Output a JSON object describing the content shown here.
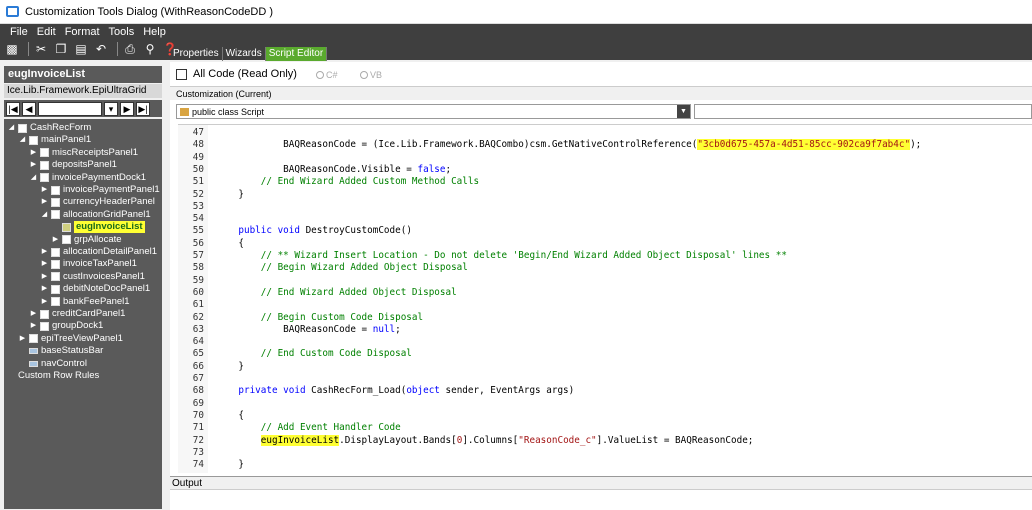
{
  "window": {
    "title": "Customization Tools Dialog  (WithReasonCodeDD )"
  },
  "menu": [
    "File",
    "Edit",
    "Format",
    "Tools",
    "Help"
  ],
  "toolbar": {
    "icons": [
      "save-icon",
      "cut-icon",
      "copy-icon",
      "paste-icon",
      "undo-icon",
      "print-icon",
      "find-icon",
      "help-icon"
    ]
  },
  "left_panel": {
    "object_name": "eugInvoiceList",
    "object_type": "Ice.Lib.Framework.EpiUltraGrid",
    "tree": [
      {
        "label": "CashRecForm",
        "indent": 0,
        "exp": "down",
        "icon": "sq"
      },
      {
        "label": "mainPanel1",
        "indent": 1,
        "exp": "down",
        "icon": "sq"
      },
      {
        "label": "miscReceiptsPanel1",
        "indent": 2,
        "exp": "right",
        "icon": "sq"
      },
      {
        "label": "depositsPanel1",
        "indent": 2,
        "exp": "right",
        "icon": "sq"
      },
      {
        "label": "invoicePaymentDock1",
        "indent": 2,
        "exp": "down",
        "icon": "sq"
      },
      {
        "label": "invoicePaymentPanel1",
        "indent": 3,
        "exp": "right",
        "icon": "sq"
      },
      {
        "label": "currencyHeaderPanel",
        "indent": 3,
        "exp": "right",
        "icon": "sq"
      },
      {
        "label": "allocationGridPanel1",
        "indent": 3,
        "exp": "down",
        "icon": "sq"
      },
      {
        "label": "eugInvoiceList",
        "indent": 4,
        "exp": "",
        "icon": "grid",
        "selected": true
      },
      {
        "label": "grpAllocate",
        "indent": 4,
        "exp": "right",
        "icon": "sq"
      },
      {
        "label": "allocationDetailPanel1",
        "indent": 3,
        "exp": "right",
        "icon": "sq"
      },
      {
        "label": "invoiceTaxPanel1",
        "indent": 3,
        "exp": "right",
        "icon": "sq"
      },
      {
        "label": "custInvoicesPanel1",
        "indent": 3,
        "exp": "right",
        "icon": "sq"
      },
      {
        "label": "debitNoteDocPanel1",
        "indent": 3,
        "exp": "right",
        "icon": "sq"
      },
      {
        "label": "bankFeePanel1",
        "indent": 3,
        "exp": "right",
        "icon": "sq"
      },
      {
        "label": "creditCardPanel1",
        "indent": 2,
        "exp": "right",
        "icon": "sq"
      },
      {
        "label": "groupDock1",
        "indent": 2,
        "exp": "right",
        "icon": "sq"
      },
      {
        "label": "epiTreeViewPanel1",
        "indent": 1,
        "exp": "right",
        "icon": "sq"
      },
      {
        "label": "baseStatusBar",
        "indent": 1,
        "exp": "",
        "icon": "bar"
      },
      {
        "label": "navControl",
        "indent": 1,
        "exp": "",
        "icon": "bar"
      },
      {
        "label": "Custom Row Rules",
        "indent": 0,
        "exp": "",
        "icon": "none"
      }
    ]
  },
  "tabs": [
    "Properties",
    "Wizards",
    "Script Editor"
  ],
  "options": {
    "all_code_label": "All Code (Read Only)",
    "radio_cs": "C#",
    "radio_vb": "VB",
    "customization_label": "Customization (Current)",
    "class_selector": "public class Script"
  },
  "code_lines": [
    {
      "n": "47",
      "segs": []
    },
    {
      "n": "48",
      "segs": [
        {
          "t": "            BAQReasonCode = (Ice.Lib.Framework.BAQCombo)csm.GetNativeControlReference("
        },
        {
          "t": "\"3cb0d675-457a-4d51-85cc-902ca9f7ab4c\"",
          "c": "str hl"
        },
        {
          "t": ");"
        }
      ]
    },
    {
      "n": "49",
      "segs": []
    },
    {
      "n": "50",
      "segs": [
        {
          "t": "            BAQReasonCode.Visible = "
        },
        {
          "t": "false",
          "c": "kw"
        },
        {
          "t": ";"
        }
      ]
    },
    {
      "n": "51",
      "segs": [
        {
          "t": "        "
        },
        {
          "t": "// End Wizard Added Custom Method Calls",
          "c": "cm"
        }
      ]
    },
    {
      "n": "52",
      "segs": [
        {
          "t": "    }"
        }
      ],
      "fold": "-"
    },
    {
      "n": "53",
      "segs": []
    },
    {
      "n": "54",
      "segs": []
    },
    {
      "n": "55",
      "segs": [
        {
          "t": "    "
        },
        {
          "t": "public void",
          "c": "kw"
        },
        {
          "t": " DestroyCustomCode()"
        }
      ]
    },
    {
      "n": "56",
      "segs": [
        {
          "t": "    {"
        }
      ],
      "fold": "⊟"
    },
    {
      "n": "57",
      "segs": [
        {
          "t": "        "
        },
        {
          "t": "// ** Wizard Insert Location - Do not delete 'Begin/End Wizard Added Object Disposal' lines **",
          "c": "cm"
        }
      ]
    },
    {
      "n": "58",
      "segs": [
        {
          "t": "        "
        },
        {
          "t": "// Begin Wizard Added Object Disposal",
          "c": "cm"
        }
      ]
    },
    {
      "n": "59",
      "segs": []
    },
    {
      "n": "60",
      "segs": [
        {
          "t": "        "
        },
        {
          "t": "// End Wizard Added Object Disposal",
          "c": "cm"
        }
      ]
    },
    {
      "n": "61",
      "segs": []
    },
    {
      "n": "62",
      "segs": [
        {
          "t": "        "
        },
        {
          "t": "// Begin Custom Code Disposal",
          "c": "cm"
        }
      ]
    },
    {
      "n": "63",
      "segs": [
        {
          "t": "            BAQReasonCode = "
        },
        {
          "t": "null",
          "c": "kw"
        },
        {
          "t": ";"
        }
      ]
    },
    {
      "n": "64",
      "segs": []
    },
    {
      "n": "65",
      "segs": [
        {
          "t": "        "
        },
        {
          "t": "// End Custom Code Disposal",
          "c": "cm"
        }
      ]
    },
    {
      "n": "66",
      "segs": [
        {
          "t": "    }"
        }
      ],
      "fold": "-"
    },
    {
      "n": "67",
      "segs": []
    },
    {
      "n": "68",
      "segs": [
        {
          "t": "    "
        },
        {
          "t": "private void",
          "c": "kw"
        },
        {
          "t": " CashRecForm_Load("
        },
        {
          "t": "object",
          "c": "kw"
        },
        {
          "t": " sender, EventArgs args)"
        }
      ]
    },
    {
      "n": "69",
      "segs": []
    },
    {
      "n": "70",
      "segs": [
        {
          "t": "    {"
        }
      ],
      "fold": "⊟"
    },
    {
      "n": "71",
      "segs": [
        {
          "t": "        "
        },
        {
          "t": "// Add Event Handler Code",
          "c": "cm"
        }
      ]
    },
    {
      "n": "72",
      "segs": [
        {
          "t": "        "
        },
        {
          "t": "eugInvoiceList",
          "c": "hl"
        },
        {
          "t": ".DisplayLayout.Bands["
        },
        {
          "t": "0",
          "c": "str"
        },
        {
          "t": "].Columns["
        },
        {
          "t": "\"ReasonCode_c\"",
          "c": "str"
        },
        {
          "t": "].ValueList = BAQReasonCode;"
        }
      ]
    },
    {
      "n": "73",
      "segs": []
    },
    {
      "n": "74",
      "segs": [
        {
          "t": "    }"
        }
      ]
    }
  ],
  "output": {
    "label": "Output"
  }
}
